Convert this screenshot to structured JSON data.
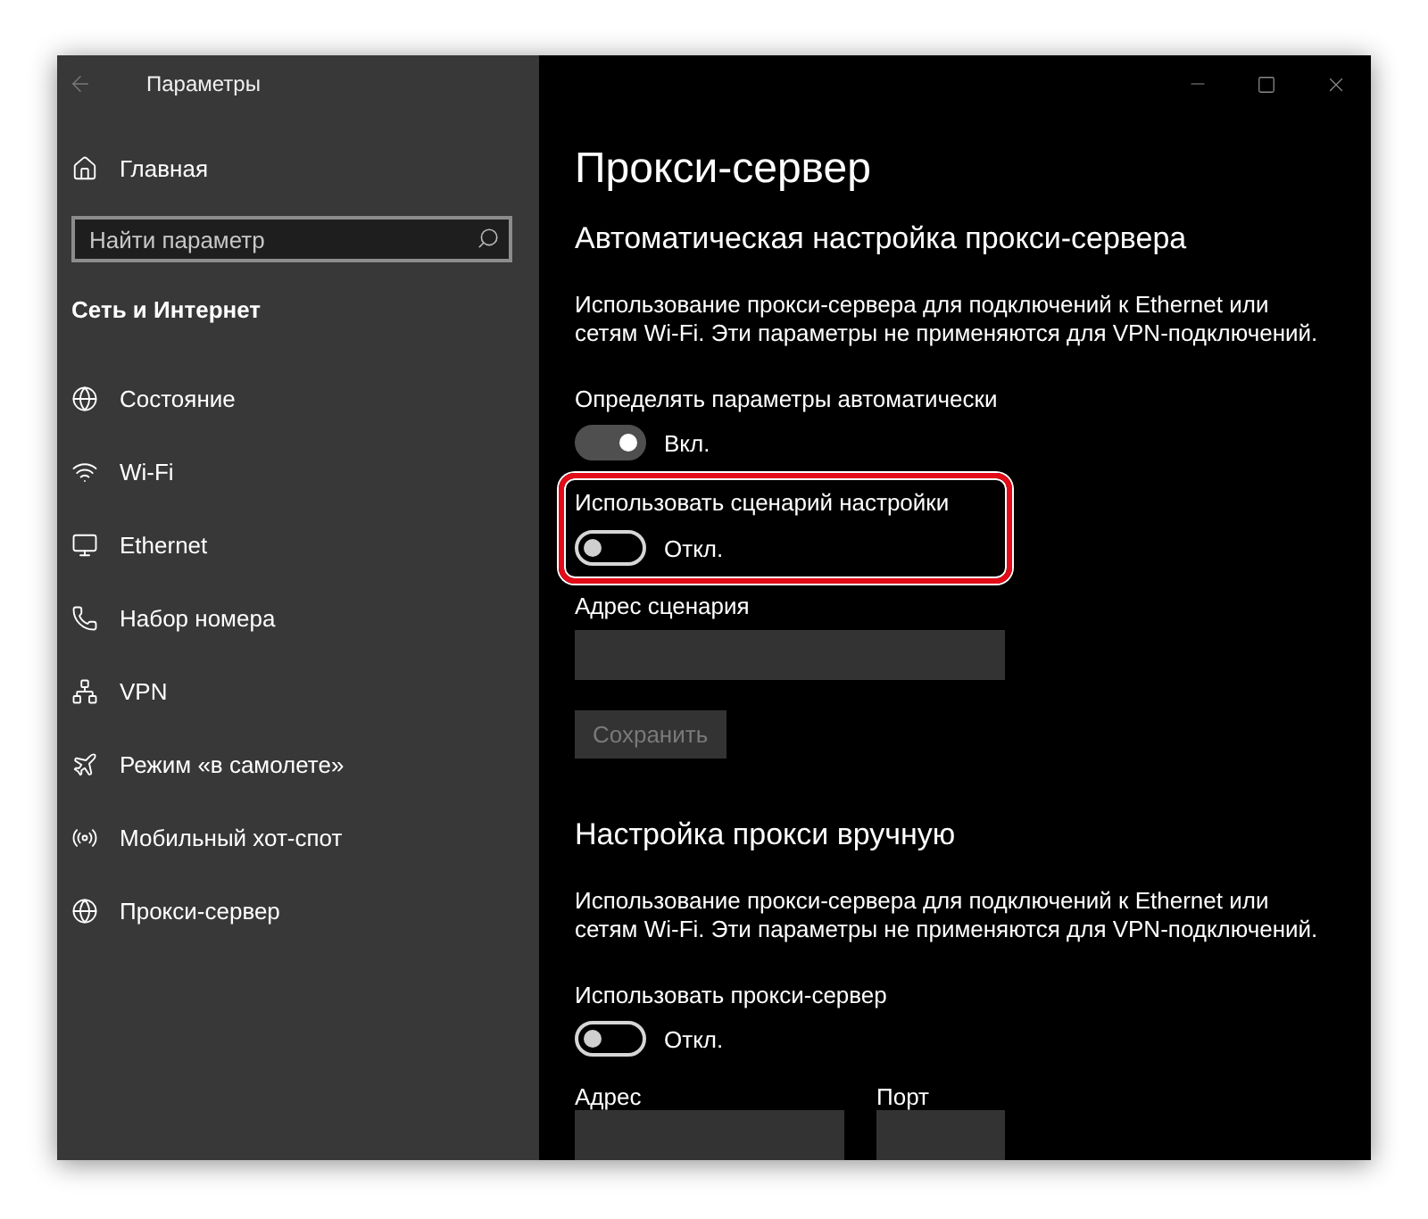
{
  "window": {
    "title": "Параметры"
  },
  "sidebar": {
    "home": "Главная",
    "search": {
      "placeholder": "Найти параметр"
    },
    "section_title": "Сеть и Интернет",
    "items": [
      "Состояние",
      "Wi-Fi",
      "Ethernet",
      "Набор номера",
      "VPN",
      "Режим «в самолете»",
      "Мобильный хот-спот",
      "Прокси-сервер"
    ]
  },
  "page": {
    "title": "Прокси-сервер",
    "sections": [
      {
        "heading": "Автоматическая настройка прокси-сервера",
        "description": "Использование прокси-сервера для подключений к Ethernet или сетям Wi-Fi. Эти параметры не применяются для VPN-подключений.",
        "settings": [
          {
            "kind": "toggle",
            "label": "Определять параметры автоматически",
            "on": true,
            "state_text": "Вкл.",
            "highlighted": false
          },
          {
            "kind": "toggle",
            "label": "Использовать сценарий настройки",
            "on": false,
            "state_text": "Откл.",
            "highlighted": true
          },
          {
            "kind": "field",
            "label": "Адрес сценария"
          },
          {
            "kind": "button",
            "label": "Сохранить",
            "disabled": true
          }
        ]
      },
      {
        "heading": "Настройка прокси вручную",
        "description": "Использование прокси-сервера для подключений к Ethernet или сетям Wi-Fi. Эти параметры не применяются для VPN-подключений.",
        "settings": [
          {
            "kind": "toggle",
            "label": "Использовать прокси-сервер",
            "on": false,
            "state_text": "Откл.",
            "highlighted": false
          },
          {
            "kind": "field_row",
            "fields": [
              {
                "label": "Адрес"
              },
              {
                "label": "Порт"
              }
            ]
          }
        ]
      }
    ]
  }
}
